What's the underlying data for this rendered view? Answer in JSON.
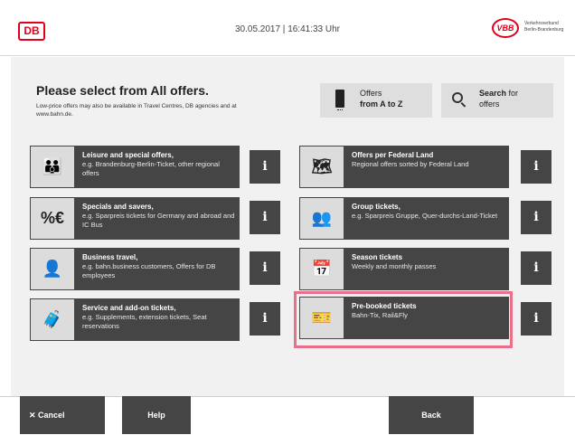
{
  "header": {
    "brand_logo": "DB",
    "datetime": "30.05.2017 | 16:41:33 Uhr",
    "partner_logo": "VBB",
    "partner_text": "Verkehrsverbund Berlin-Brandenburg"
  },
  "intro": {
    "title": "Please select from All offers.",
    "subtext": "Low-price offers may also be available in Travel Centres, DB agencies and at www.bahn.de."
  },
  "top_buttons": {
    "az": {
      "line1": "Offers",
      "line2": "from A to Z",
      "icon": "phone-icon"
    },
    "search": {
      "bold": "Search",
      "rest": " for",
      "line2": "offers",
      "icon": "search-icon"
    }
  },
  "offers_left": [
    {
      "title": "Leisure and special offers,",
      "desc": "e.g. Brandenburg-Berlin-Ticket, other regional offers",
      "icon": "family-icon"
    },
    {
      "title": "Specials and savers,",
      "desc": "e.g. Sparpreis tickets for Germany and abroad and IC Bus",
      "icon": "percent-euro-icon"
    },
    {
      "title": "Business travel,",
      "desc": "e.g. bahn.business customers, Offers for DB employees",
      "icon": "business-person-icon"
    },
    {
      "title": "Service and add-on tickets,",
      "desc": "e.g. Supplements, extension tickets, Seat reservations",
      "icon": "luggage-icon"
    }
  ],
  "offers_right": [
    {
      "title": "Offers per Federal Land",
      "desc": "Regional offers sorted by Federal Land",
      "icon": "germany-map-icon"
    },
    {
      "title": "Group tickets,",
      "desc": "e.g. Sparpreis Gruppe, Quer-durchs-Land-Ticket",
      "icon": "group-icon"
    },
    {
      "title": "Season tickets",
      "desc": "Weekly and monthly passes",
      "icon": "calendar-clock-icon"
    },
    {
      "title": "Pre-booked tickets",
      "desc": "Bahn-Tix, Rail&Fly",
      "icon": "ticket-print-icon"
    }
  ],
  "info_label": "i",
  "footer": {
    "cancel": "✕ Cancel",
    "help": "Help",
    "back": "Back"
  },
  "colors": {
    "brand_red": "#e2001a",
    "tile_dark": "#454545",
    "highlight": "#e8708a"
  }
}
